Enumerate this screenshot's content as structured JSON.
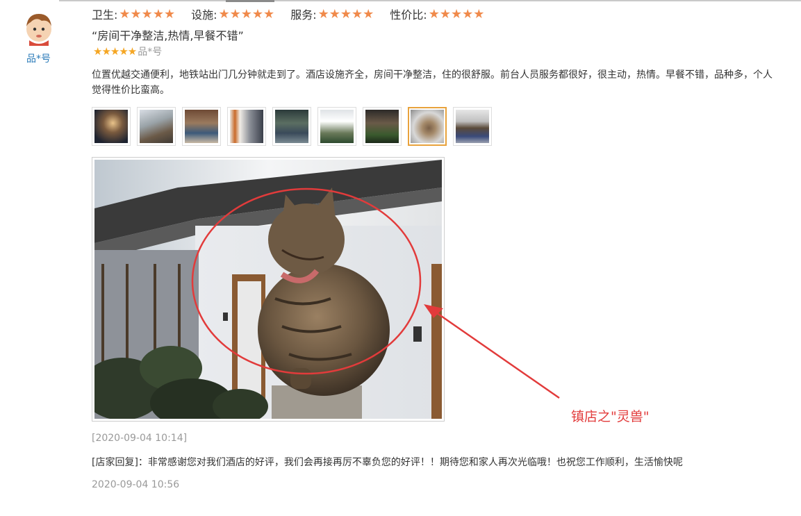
{
  "ratings": [
    {
      "label": "卫生:",
      "stars": "★★★★★"
    },
    {
      "label": "设施:",
      "stars": "★★★★★"
    },
    {
      "label": "服务:",
      "stars": "★★★★★"
    },
    {
      "label": "性价比:",
      "stars": "★★★★★"
    }
  ],
  "user": {
    "name": "品*号",
    "avatar_icon": "cartoon-boy-avatar"
  },
  "review": {
    "title": "“房间干净整洁,热情,早餐不错”",
    "overall_stars": "★★★★★",
    "author": "品*号",
    "text": "位置优越交通便利，地铁站出门几分钟就走到了。酒店设施齐全，房间干净整洁，住的很舒服。前台人员服务都很好，很主动，热情。早餐不错，品种多，个人觉得性价比蛮高。",
    "date": "[2020-09-04 10:14]"
  },
  "thumbnails_count_label": "",
  "annotation": {
    "text": "镇店之\"灵兽\"",
    "color": "#e23b3b"
  },
  "reply": {
    "text": "[店家回复]：非常感谢您对我们酒店的好评，我们会再接再厉不辜负您的好评！！期待您和家人再次光临哦！也祝您工作顺利，生活愉快呢",
    "date": "2020-09-04 10:56"
  },
  "colors": {
    "star": "#f08a4b",
    "small_star": "#f5a623",
    "thumb_active_border": "#e8a23c"
  }
}
